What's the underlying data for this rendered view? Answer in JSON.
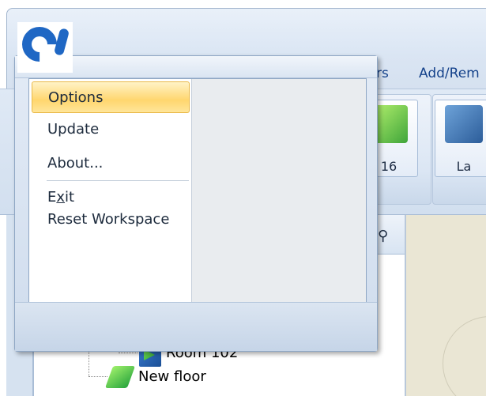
{
  "ribbon": {
    "tabs": [
      "rs",
      "Add/Rem"
    ],
    "buttons": [
      {
        "label": "16",
        "icon": "location-icon"
      },
      {
        "label": "La",
        "icon": "layout-icon"
      }
    ]
  },
  "app_menu": {
    "items": [
      {
        "label": "Options",
        "selected": true
      },
      {
        "label": "Update"
      },
      {
        "label": "About..."
      },
      {
        "label": "Exit",
        "accelerator": "x"
      },
      {
        "label": "Reset Workspace"
      }
    ]
  },
  "tree": {
    "items": [
      {
        "label": "Room 102",
        "icon": "room-icon"
      },
      {
        "label": "New floor",
        "icon": "floor-icon"
      }
    ]
  },
  "colors": {
    "accent": "#1f67c4",
    "selection": "#ffd66e",
    "ribbon_text": "#15428b"
  }
}
